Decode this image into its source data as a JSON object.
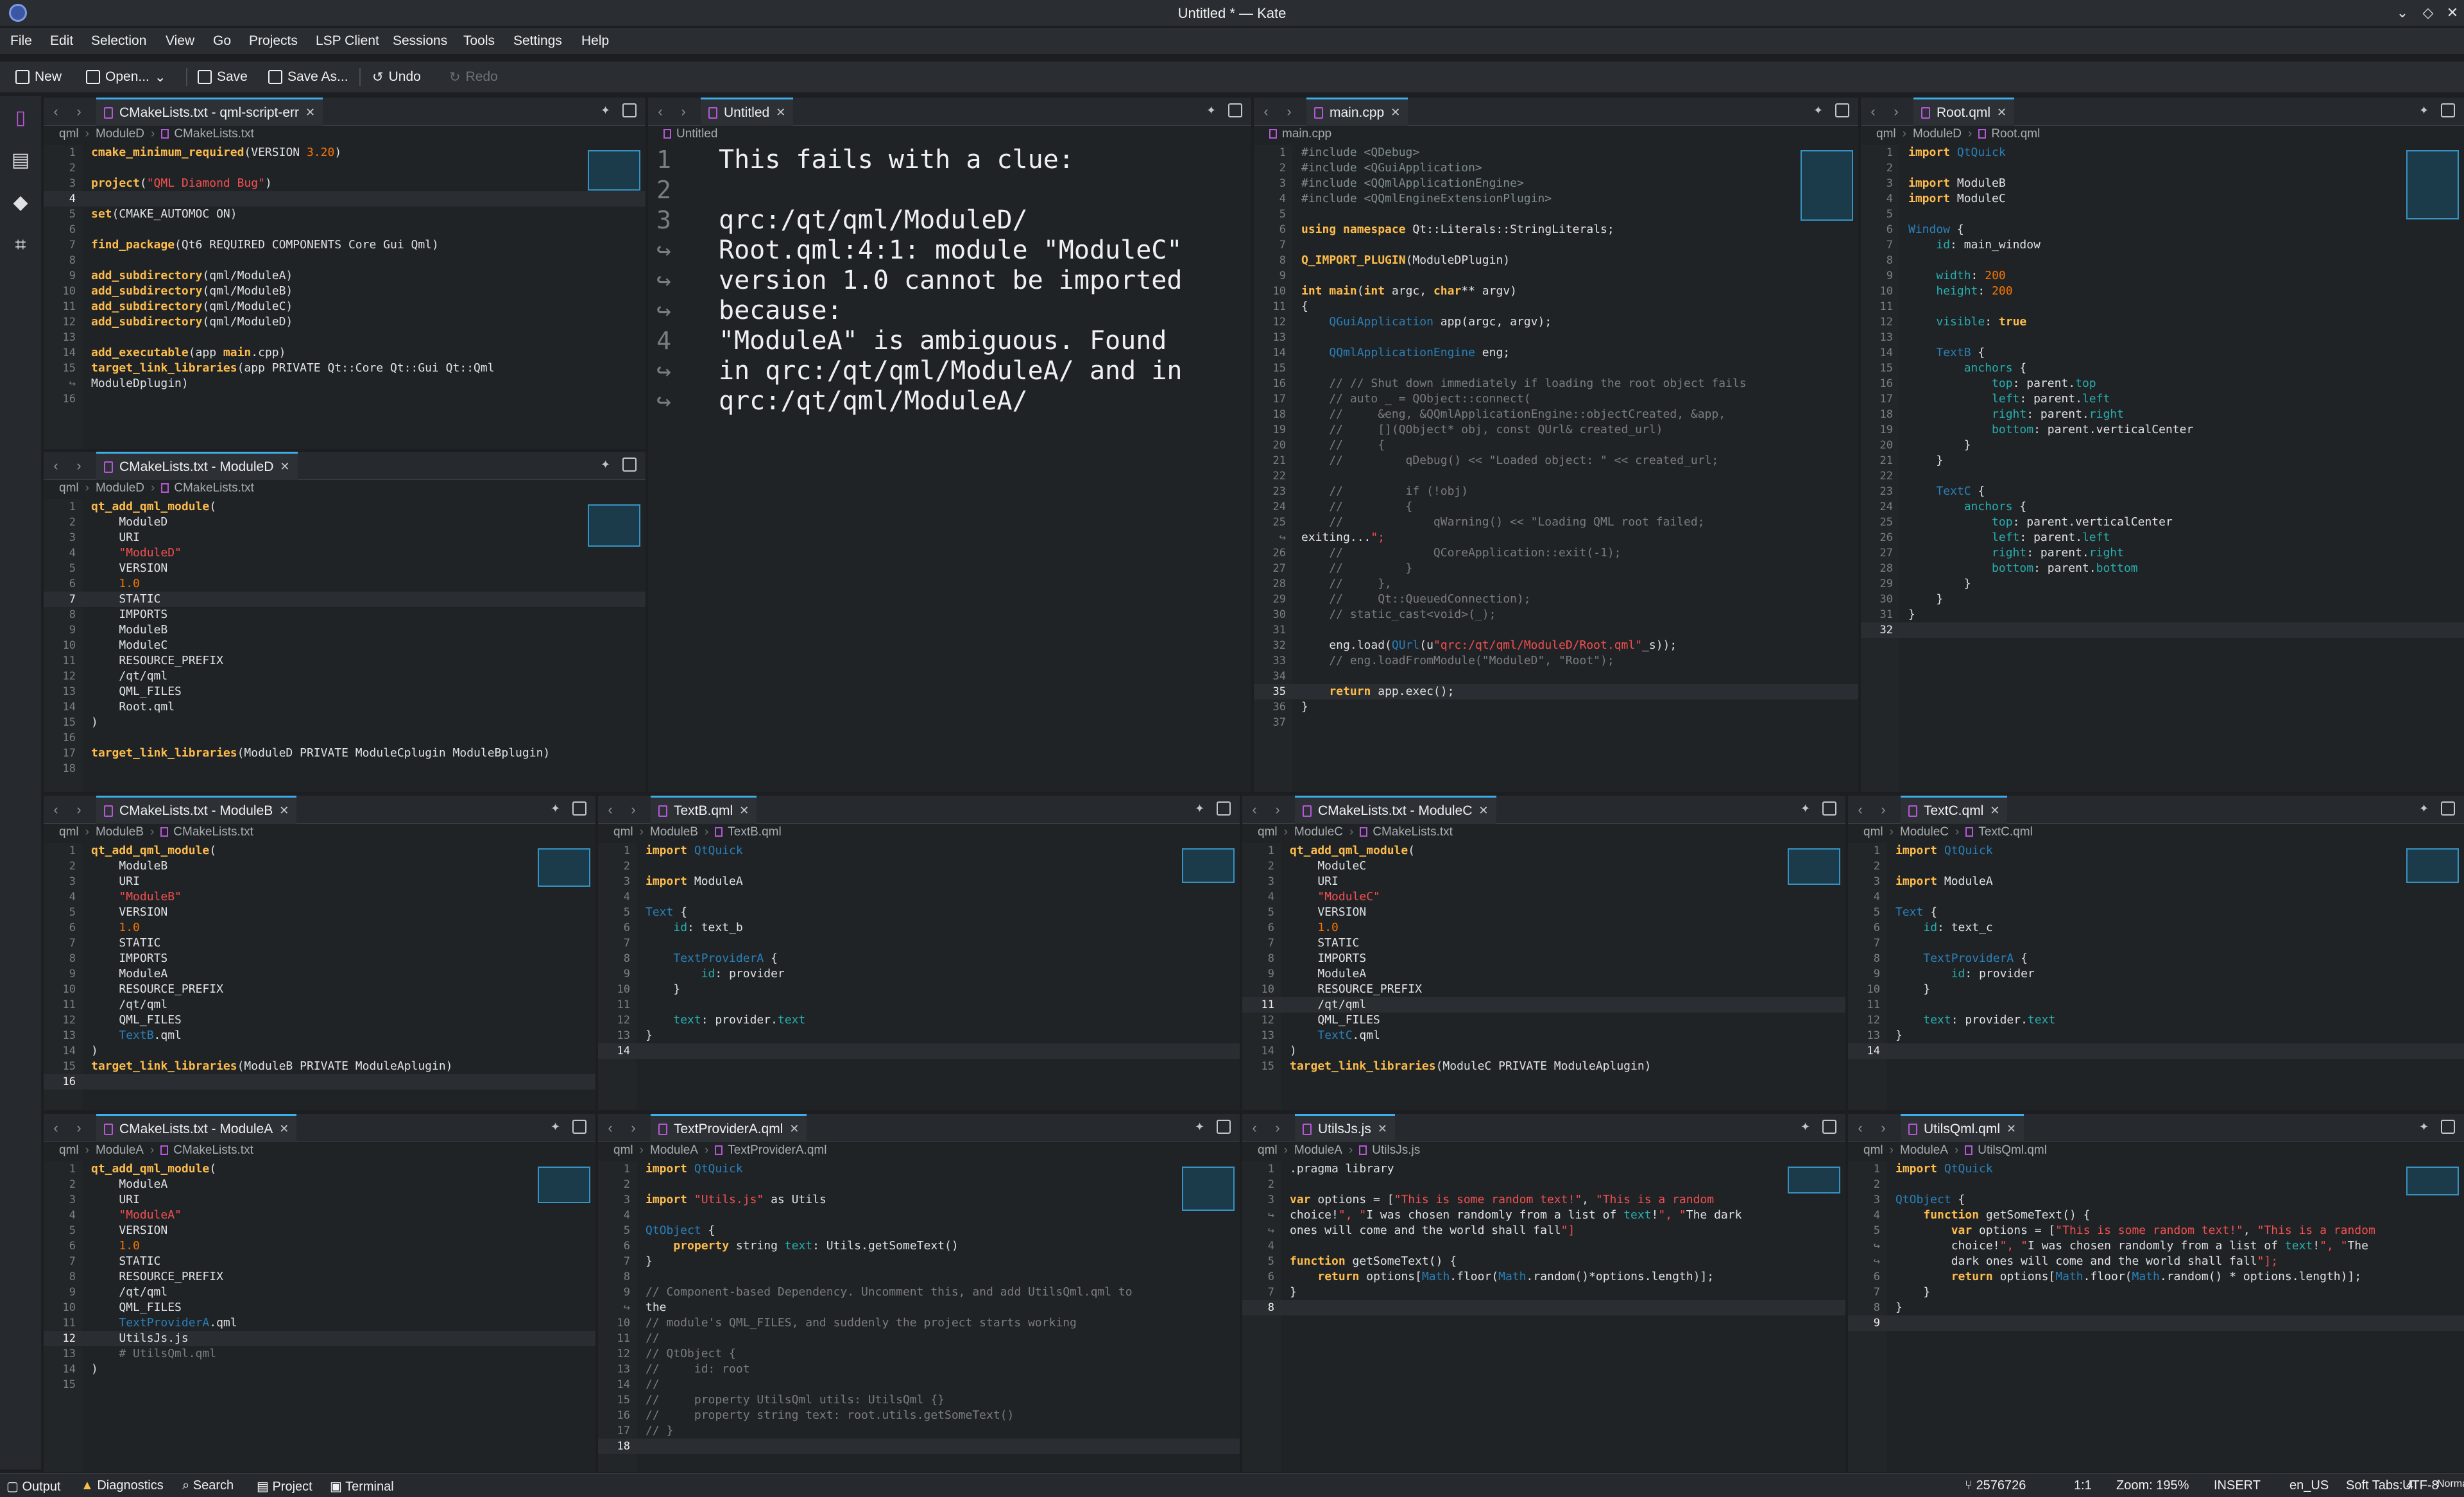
{
  "window": {
    "title": "Untitled * — Kate"
  },
  "menu": [
    "File",
    "Edit",
    "Selection",
    "View",
    "Go",
    "Projects",
    "LSP Client",
    "Sessions",
    "Tools",
    "Settings",
    "Help"
  ],
  "toolbar": {
    "new": "New",
    "open": "Open...",
    "save": "Save",
    "save_as": "Save As...",
    "undo": "Undo",
    "redo": "Redo"
  },
  "statusbar": {
    "output": "Output",
    "diagnostics": "Diagnostics",
    "search": "Search",
    "project": "Project",
    "terminal": "Terminal",
    "branch": "2576726",
    "position": "1:1",
    "zoom": "Zoom: 195%",
    "mode": "INSERT",
    "lang": "en_US",
    "tabs": "Soft Tabs: 4",
    "encoding": "UTF-8",
    "input": "Normal"
  },
  "panes": [
    {
      "tab": "CMakeLists.txt - qml-script-err",
      "crumb": [
        "qml",
        "ModuleD",
        "CMakeLists.txt"
      ],
      "lines": [
        [
          "1",
          "cmake_minimum_required(VERSION 3.20)"
        ],
        [
          "2",
          ""
        ],
        [
          "3",
          "project(\"QML Diamond Bug\")"
        ],
        [
          "4",
          ""
        ],
        [
          "5",
          "set(CMAKE_AUTOMOC ON)"
        ],
        [
          "6",
          ""
        ],
        [
          "7",
          "find_package(Qt6 REQUIRED COMPONENTS Core Gui Qml)"
        ],
        [
          "8",
          ""
        ],
        [
          "9",
          "add_subdirectory(qml/ModuleA)"
        ],
        [
          "10",
          "add_subdirectory(qml/ModuleB)"
        ],
        [
          "11",
          "add_subdirectory(qml/ModuleC)"
        ],
        [
          "12",
          "add_subdirectory(qml/ModuleD)"
        ],
        [
          "13",
          ""
        ],
        [
          "14",
          "add_executable(app main.cpp)"
        ],
        [
          "15",
          "target_link_libraries(app PRIVATE Qt::Core Qt::Gui Qt::Qml"
        ],
        [
          "↪",
          "ModuleDplugin)"
        ],
        [
          "16",
          ""
        ]
      ]
    },
    {
      "tab": "Untitled",
      "crumb": [
        "Untitled"
      ],
      "lines": [
        [
          "1",
          "This fails with a clue:"
        ],
        [
          "2",
          ""
        ],
        [
          "3",
          "qrc:/qt/qml/ModuleD/"
        ],
        [
          "↪",
          "Root.qml:4:1: module \"ModuleC\""
        ],
        [
          "↪",
          "version 1.0 cannot be imported"
        ],
        [
          "↪",
          "because:"
        ],
        [
          "4",
          "\"ModuleA\" is ambiguous. Found"
        ],
        [
          "↪",
          "in qrc:/qt/qml/ModuleA/ and in"
        ],
        [
          "↪",
          "qrc:/qt/qml/ModuleA/"
        ]
      ]
    },
    {
      "tab": "main.cpp",
      "crumb": [
        "main.cpp"
      ],
      "lines": [
        [
          "1",
          "#include <QDebug>"
        ],
        [
          "2",
          "#include <QGuiApplication>"
        ],
        [
          "3",
          "#include <QQmlApplicationEngine>"
        ],
        [
          "4",
          "#include <QQmlEngineExtensionPlugin>"
        ],
        [
          "5",
          ""
        ],
        [
          "6",
          "using namespace Qt::Literals::StringLiterals;"
        ],
        [
          "7",
          ""
        ],
        [
          "8",
          "Q_IMPORT_PLUGIN(ModuleDPlugin)"
        ],
        [
          "9",
          ""
        ],
        [
          "10",
          "int main(int argc, char** argv)"
        ],
        [
          "11",
          "{"
        ],
        [
          "12",
          "    QGuiApplication app(argc, argv);"
        ],
        [
          "13",
          ""
        ],
        [
          "14",
          "    QQmlApplicationEngine eng;"
        ],
        [
          "15",
          ""
        ],
        [
          "16",
          "    // // Shut down immediately if loading the root object fails"
        ],
        [
          "17",
          "    // auto _ = QObject::connect("
        ],
        [
          "18",
          "    //     &eng, &QQmlApplicationEngine::objectCreated, &app,"
        ],
        [
          "19",
          "    //     [](QObject* obj, const QUrl& created_url)"
        ],
        [
          "20",
          "    //     {"
        ],
        [
          "21",
          "    //         qDebug() << \"Loaded object: \" << created_url;"
        ],
        [
          "22",
          ""
        ],
        [
          "23",
          "    //         if (!obj)"
        ],
        [
          "24",
          "    //         {"
        ],
        [
          "25",
          "    //             qWarning() << \"Loading QML root failed;"
        ],
        [
          "↪",
          "exiting...\";"
        ],
        [
          "26",
          "    //             QCoreApplication::exit(-1);"
        ],
        [
          "27",
          "    //         }"
        ],
        [
          "28",
          "    //     },"
        ],
        [
          "29",
          "    //     Qt::QueuedConnection);"
        ],
        [
          "30",
          "    // static_cast<void>(_);"
        ],
        [
          "31",
          ""
        ],
        [
          "32",
          "    eng.load(QUrl(u\"qrc:/qt/qml/ModuleD/Root.qml\"_s));"
        ],
        [
          "33",
          "    // eng.loadFromModule(\"ModuleD\", \"Root\");"
        ],
        [
          "34",
          ""
        ],
        [
          "35",
          "    return app.exec();"
        ],
        [
          "36",
          "}"
        ],
        [
          "37",
          ""
        ]
      ]
    },
    {
      "tab": "Root.qml",
      "crumb": [
        "qml",
        "ModuleD",
        "Root.qml"
      ],
      "lines": [
        [
          "1",
          "import QtQuick"
        ],
        [
          "2",
          ""
        ],
        [
          "3",
          "import ModuleB"
        ],
        [
          "4",
          "import ModuleC"
        ],
        [
          "5",
          ""
        ],
        [
          "6",
          "Window {"
        ],
        [
          "7",
          "    id: main_window"
        ],
        [
          "8",
          ""
        ],
        [
          "9",
          "    width: 200"
        ],
        [
          "10",
          "    height: 200"
        ],
        [
          "11",
          ""
        ],
        [
          "12",
          "    visible: true"
        ],
        [
          "13",
          ""
        ],
        [
          "14",
          "    TextB {"
        ],
        [
          "15",
          "        anchors {"
        ],
        [
          "16",
          "            top: parent.top"
        ],
        [
          "17",
          "            left: parent.left"
        ],
        [
          "18",
          "            right: parent.right"
        ],
        [
          "19",
          "            bottom: parent.verticalCenter"
        ],
        [
          "20",
          "        }"
        ],
        [
          "21",
          "    }"
        ],
        [
          "22",
          ""
        ],
        [
          "23",
          "    TextC {"
        ],
        [
          "24",
          "        anchors {"
        ],
        [
          "25",
          "            top: parent.verticalCenter"
        ],
        [
          "26",
          "            left: parent.left"
        ],
        [
          "27",
          "            right: parent.right"
        ],
        [
          "28",
          "            bottom: parent.bottom"
        ],
        [
          "29",
          "        }"
        ],
        [
          "30",
          "    }"
        ],
        [
          "31",
          "}"
        ],
        [
          "32",
          ""
        ]
      ]
    },
    {
      "tab": "CMakeLists.txt - ModuleD",
      "crumb": [
        "qml",
        "ModuleD",
        "CMakeLists.txt"
      ],
      "lines": [
        [
          "1",
          "qt_add_qml_module("
        ],
        [
          "2",
          "    ModuleD"
        ],
        [
          "3",
          "    URI"
        ],
        [
          "4",
          "    \"ModuleD\""
        ],
        [
          "5",
          "    VERSION"
        ],
        [
          "6",
          "    1.0"
        ],
        [
          "7",
          "    STATIC"
        ],
        [
          "8",
          "    IMPORTS"
        ],
        [
          "9",
          "    ModuleB"
        ],
        [
          "10",
          "    ModuleC"
        ],
        [
          "11",
          "    RESOURCE_PREFIX"
        ],
        [
          "12",
          "    /qt/qml"
        ],
        [
          "13",
          "    QML_FILES"
        ],
        [
          "14",
          "    Root.qml"
        ],
        [
          "15",
          ")"
        ],
        [
          "16",
          ""
        ],
        [
          "17",
          "target_link_libraries(ModuleD PRIVATE ModuleCplugin ModuleBplugin)"
        ],
        [
          "18",
          ""
        ]
      ]
    },
    {
      "tab": "CMakeLists.txt - ModuleB",
      "crumb": [
        "qml",
        "ModuleB",
        "CMakeLists.txt"
      ],
      "lines": [
        [
          "1",
          "qt_add_qml_module("
        ],
        [
          "2",
          "    ModuleB"
        ],
        [
          "3",
          "    URI"
        ],
        [
          "4",
          "    \"ModuleB\""
        ],
        [
          "5",
          "    VERSION"
        ],
        [
          "6",
          "    1.0"
        ],
        [
          "7",
          "    STATIC"
        ],
        [
          "8",
          "    IMPORTS"
        ],
        [
          "9",
          "    ModuleA"
        ],
        [
          "10",
          "    RESOURCE_PREFIX"
        ],
        [
          "11",
          "    /qt/qml"
        ],
        [
          "12",
          "    QML_FILES"
        ],
        [
          "13",
          "    TextB.qml"
        ],
        [
          "14",
          ")"
        ],
        [
          "15",
          "target_link_libraries(ModuleB PRIVATE ModuleAplugin)"
        ],
        [
          "16",
          ""
        ]
      ]
    },
    {
      "tab": "TextB.qml",
      "crumb": [
        "qml",
        "ModuleB",
        "TextB.qml"
      ],
      "lines": [
        [
          "1",
          "import QtQuick"
        ],
        [
          "2",
          ""
        ],
        [
          "3",
          "import ModuleA"
        ],
        [
          "4",
          ""
        ],
        [
          "5",
          "Text {"
        ],
        [
          "6",
          "    id: text_b"
        ],
        [
          "7",
          ""
        ],
        [
          "8",
          "    TextProviderA {"
        ],
        [
          "9",
          "        id: provider"
        ],
        [
          "10",
          "    }"
        ],
        [
          "11",
          ""
        ],
        [
          "12",
          "    text: provider.text"
        ],
        [
          "13",
          "}"
        ],
        [
          "14",
          ""
        ]
      ]
    },
    {
      "tab": "CMakeLists.txt - ModuleC",
      "crumb": [
        "qml",
        "ModuleC",
        "CMakeLists.txt"
      ],
      "lines": [
        [
          "1",
          "qt_add_qml_module("
        ],
        [
          "2",
          "    ModuleC"
        ],
        [
          "3",
          "    URI"
        ],
        [
          "4",
          "    \"ModuleC\""
        ],
        [
          "5",
          "    VERSION"
        ],
        [
          "6",
          "    1.0"
        ],
        [
          "7",
          "    STATIC"
        ],
        [
          "8",
          "    IMPORTS"
        ],
        [
          "9",
          "    ModuleA"
        ],
        [
          "10",
          "    RESOURCE_PREFIX"
        ],
        [
          "11",
          "    /qt/qml"
        ],
        [
          "12",
          "    QML_FILES"
        ],
        [
          "13",
          "    TextC.qml"
        ],
        [
          "14",
          ")"
        ],
        [
          "15",
          "target_link_libraries(ModuleC PRIVATE ModuleAplugin)"
        ]
      ]
    },
    {
      "tab": "TextC.qml",
      "crumb": [
        "qml",
        "ModuleC",
        "TextC.qml"
      ],
      "lines": [
        [
          "1",
          "import QtQuick"
        ],
        [
          "2",
          ""
        ],
        [
          "3",
          "import ModuleA"
        ],
        [
          "4",
          ""
        ],
        [
          "5",
          "Text {"
        ],
        [
          "6",
          "    id: text_c"
        ],
        [
          "7",
          ""
        ],
        [
          "8",
          "    TextProviderA {"
        ],
        [
          "9",
          "        id: provider"
        ],
        [
          "10",
          "    }"
        ],
        [
          "11",
          ""
        ],
        [
          "12",
          "    text: provider.text"
        ],
        [
          "13",
          "}"
        ],
        [
          "14",
          ""
        ]
      ]
    },
    {
      "tab": "CMakeLists.txt - ModuleA",
      "crumb": [
        "qml",
        "ModuleA",
        "CMakeLists.txt"
      ],
      "lines": [
        [
          "1",
          "qt_add_qml_module("
        ],
        [
          "2",
          "    ModuleA"
        ],
        [
          "3",
          "    URI"
        ],
        [
          "4",
          "    \"ModuleA\""
        ],
        [
          "5",
          "    VERSION"
        ],
        [
          "6",
          "    1.0"
        ],
        [
          "7",
          "    STATIC"
        ],
        [
          "8",
          "    RESOURCE_PREFIX"
        ],
        [
          "9",
          "    /qt/qml"
        ],
        [
          "10",
          "    QML_FILES"
        ],
        [
          "11",
          "    TextProviderA.qml"
        ],
        [
          "12",
          "    UtilsJs.js"
        ],
        [
          "13",
          "    # UtilsQml.qml"
        ],
        [
          "14",
          ")"
        ],
        [
          "15",
          ""
        ]
      ]
    },
    {
      "tab": "TextProviderA.qml",
      "crumb": [
        "qml",
        "ModuleA",
        "TextProviderA.qml"
      ],
      "lines": [
        [
          "1",
          "import QtQuick"
        ],
        [
          "2",
          ""
        ],
        [
          "3",
          "import \"Utils.js\" as Utils"
        ],
        [
          "4",
          ""
        ],
        [
          "5",
          "QtObject {"
        ],
        [
          "6",
          "    property string text: Utils.getSomeText()"
        ],
        [
          "7",
          "}"
        ],
        [
          "8",
          ""
        ],
        [
          "9",
          "// Component-based Dependency. Uncomment this, and add UtilsQml.qml to"
        ],
        [
          "↪",
          "the"
        ],
        [
          "10",
          "// module's QML_FILES, and suddenly the project starts working"
        ],
        [
          "11",
          "//"
        ],
        [
          "12",
          "// QtObject {"
        ],
        [
          "13",
          "//     id: root"
        ],
        [
          "14",
          "//"
        ],
        [
          "15",
          "//     property UtilsQml utils: UtilsQml {}"
        ],
        [
          "16",
          "//     property string text: root.utils.getSomeText()"
        ],
        [
          "17",
          "// }"
        ],
        [
          "18",
          ""
        ]
      ]
    },
    {
      "tab": "UtilsJs.js",
      "crumb": [
        "qml",
        "ModuleA",
        "UtilsJs.js"
      ],
      "lines": [
        [
          "1",
          ".pragma library"
        ],
        [
          "2",
          ""
        ],
        [
          "3",
          "var options = [\"This is some random text!\", \"This is a random"
        ],
        [
          "↪",
          "choice!\", \"I was chosen randomly from a list of text!\", \"The dark"
        ],
        [
          "↪",
          "ones will come and the world shall fall\"]"
        ],
        [
          "4",
          ""
        ],
        [
          "5",
          "function getSomeText() {"
        ],
        [
          "6",
          "    return options[Math.floor(Math.random()*options.length)];"
        ],
        [
          "7",
          "}"
        ],
        [
          "8",
          ""
        ]
      ]
    },
    {
      "tab": "UtilsQml.qml",
      "crumb": [
        "qml",
        "ModuleA",
        "UtilsQml.qml"
      ],
      "lines": [
        [
          "1",
          "import QtQuick"
        ],
        [
          "2",
          ""
        ],
        [
          "3",
          "QtObject {"
        ],
        [
          "4",
          "    function getSomeText() {"
        ],
        [
          "5",
          "        var options = [\"This is some random text!\", \"This is a random"
        ],
        [
          "↪",
          "        choice!\", \"I was chosen randomly from a list of text!\", \"The"
        ],
        [
          "↪",
          "        dark ones will come and the world shall fall\"];"
        ],
        [
          "6",
          "        return options[Math.floor(Math.random() * options.length)];"
        ],
        [
          "7",
          "    }"
        ],
        [
          "8",
          "}"
        ],
        [
          "9",
          ""
        ]
      ]
    }
  ]
}
